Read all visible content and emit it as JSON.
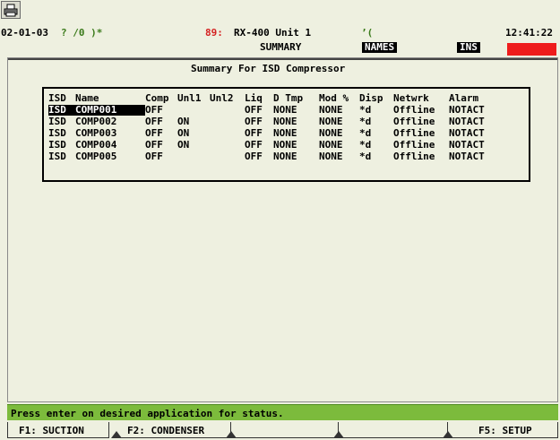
{
  "toolbar": {
    "print_icon": "printer-icon"
  },
  "header": {
    "date": "02-01-03",
    "flags": "? /0 )*",
    "unit_prefix": "89:",
    "unit_name": "RX-400 Unit 1",
    "mark": "’(",
    "time": "12:41:22",
    "screen_title": "SUMMARY",
    "names_label": "NAMES",
    "ins_label": "INS",
    "alarm_color": "#ee1c1c"
  },
  "main": {
    "title": "Summary For ISD Compressor",
    "columns": [
      "ISD",
      "Name",
      "Comp",
      "Unl1",
      "Unl2",
      "Liq",
      "D Tmp",
      "Mod %",
      "Disp",
      "Netwrk",
      "Alarm"
    ],
    "rows": [
      [
        "ISD",
        "COMP001",
        "OFF",
        "",
        "",
        "OFF",
        "NONE",
        "NONE",
        "*d",
        "Offline",
        "NOTACT"
      ],
      [
        "ISD",
        "COMP002",
        "OFF",
        "ON",
        "",
        "OFF",
        "NONE",
        "NONE",
        "*d",
        "Offline",
        "NOTACT"
      ],
      [
        "ISD",
        "COMP003",
        "OFF",
        "ON",
        "",
        "OFF",
        "NONE",
        "NONE",
        "*d",
        "Offline",
        "NOTACT"
      ],
      [
        "ISD",
        "COMP004",
        "OFF",
        "ON",
        "",
        "OFF",
        "NONE",
        "NONE",
        "*d",
        "Offline",
        "NOTACT"
      ],
      [
        "ISD",
        "COMP005",
        "OFF",
        "",
        "",
        "OFF",
        "NONE",
        "NONE",
        "*d",
        "Offline",
        "NOTACT"
      ]
    ]
  },
  "status": {
    "message": "Press enter on desired application for status.",
    "bar_color": "#7cbb3c"
  },
  "fkeys": [
    {
      "label": "F1: SUCTION"
    },
    {
      "label": "F2: CONDENSER"
    },
    {
      "label": ""
    },
    {
      "label": ""
    },
    {
      "label": "F5: SETUP"
    }
  ]
}
